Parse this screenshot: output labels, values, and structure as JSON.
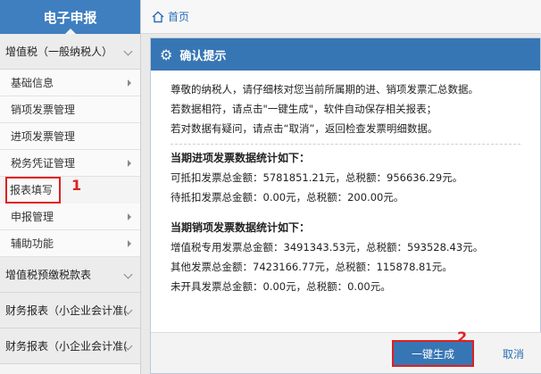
{
  "sidebar": {
    "title": "电子申报",
    "section_vat": "增值税（一般纳税人）",
    "items": [
      {
        "label": "基础信息",
        "has_sub": true
      },
      {
        "label": "销项发票管理",
        "has_sub": false
      },
      {
        "label": "进项发票管理",
        "has_sub": false
      },
      {
        "label": "税务凭证管理",
        "has_sub": true
      },
      {
        "label": "报表填写",
        "has_sub": false
      },
      {
        "label": "申报管理",
        "has_sub": true
      },
      {
        "label": "辅助功能",
        "has_sub": true
      }
    ],
    "section_prepay": "增值税预缴税款表",
    "section_fin1": "财务报表（小企业会计准(",
    "section_fin2": "财务报表（小企业会计准("
  },
  "markers": {
    "one": "1",
    "two": "2"
  },
  "topbar": {
    "home_label": "首页"
  },
  "dialog": {
    "title": "确认提示",
    "intro_lines": [
      "尊敬的纳税人，请仔细核对您当前所属期的进、销项发票汇总数据。",
      "若数据相符，请点击\"一键生成\"，软件自动保存相关报表；",
      "若对数据有疑问，请点击“取消”，返回检查发票明细数据。"
    ],
    "input_heading": "当期进项发票数据统计如下：",
    "input_lines": [
      "可抵扣发票总金额：5781851.21元，总税额：956636.29元。",
      "待抵扣发票总金额：0.00元，总税额：200.00元。"
    ],
    "output_heading": "当期销项发票数据统计如下：",
    "output_lines": [
      "增值税专用发票总金额：3491343.53元，总税额：593528.43元。",
      "其他发票总金额：7423166.77元，总税额：115878.81元。",
      "未开具发票总金额：0.00元，总税额：0.00元。"
    ],
    "confirm_label": "一键生成",
    "cancel_label": "取消"
  }
}
